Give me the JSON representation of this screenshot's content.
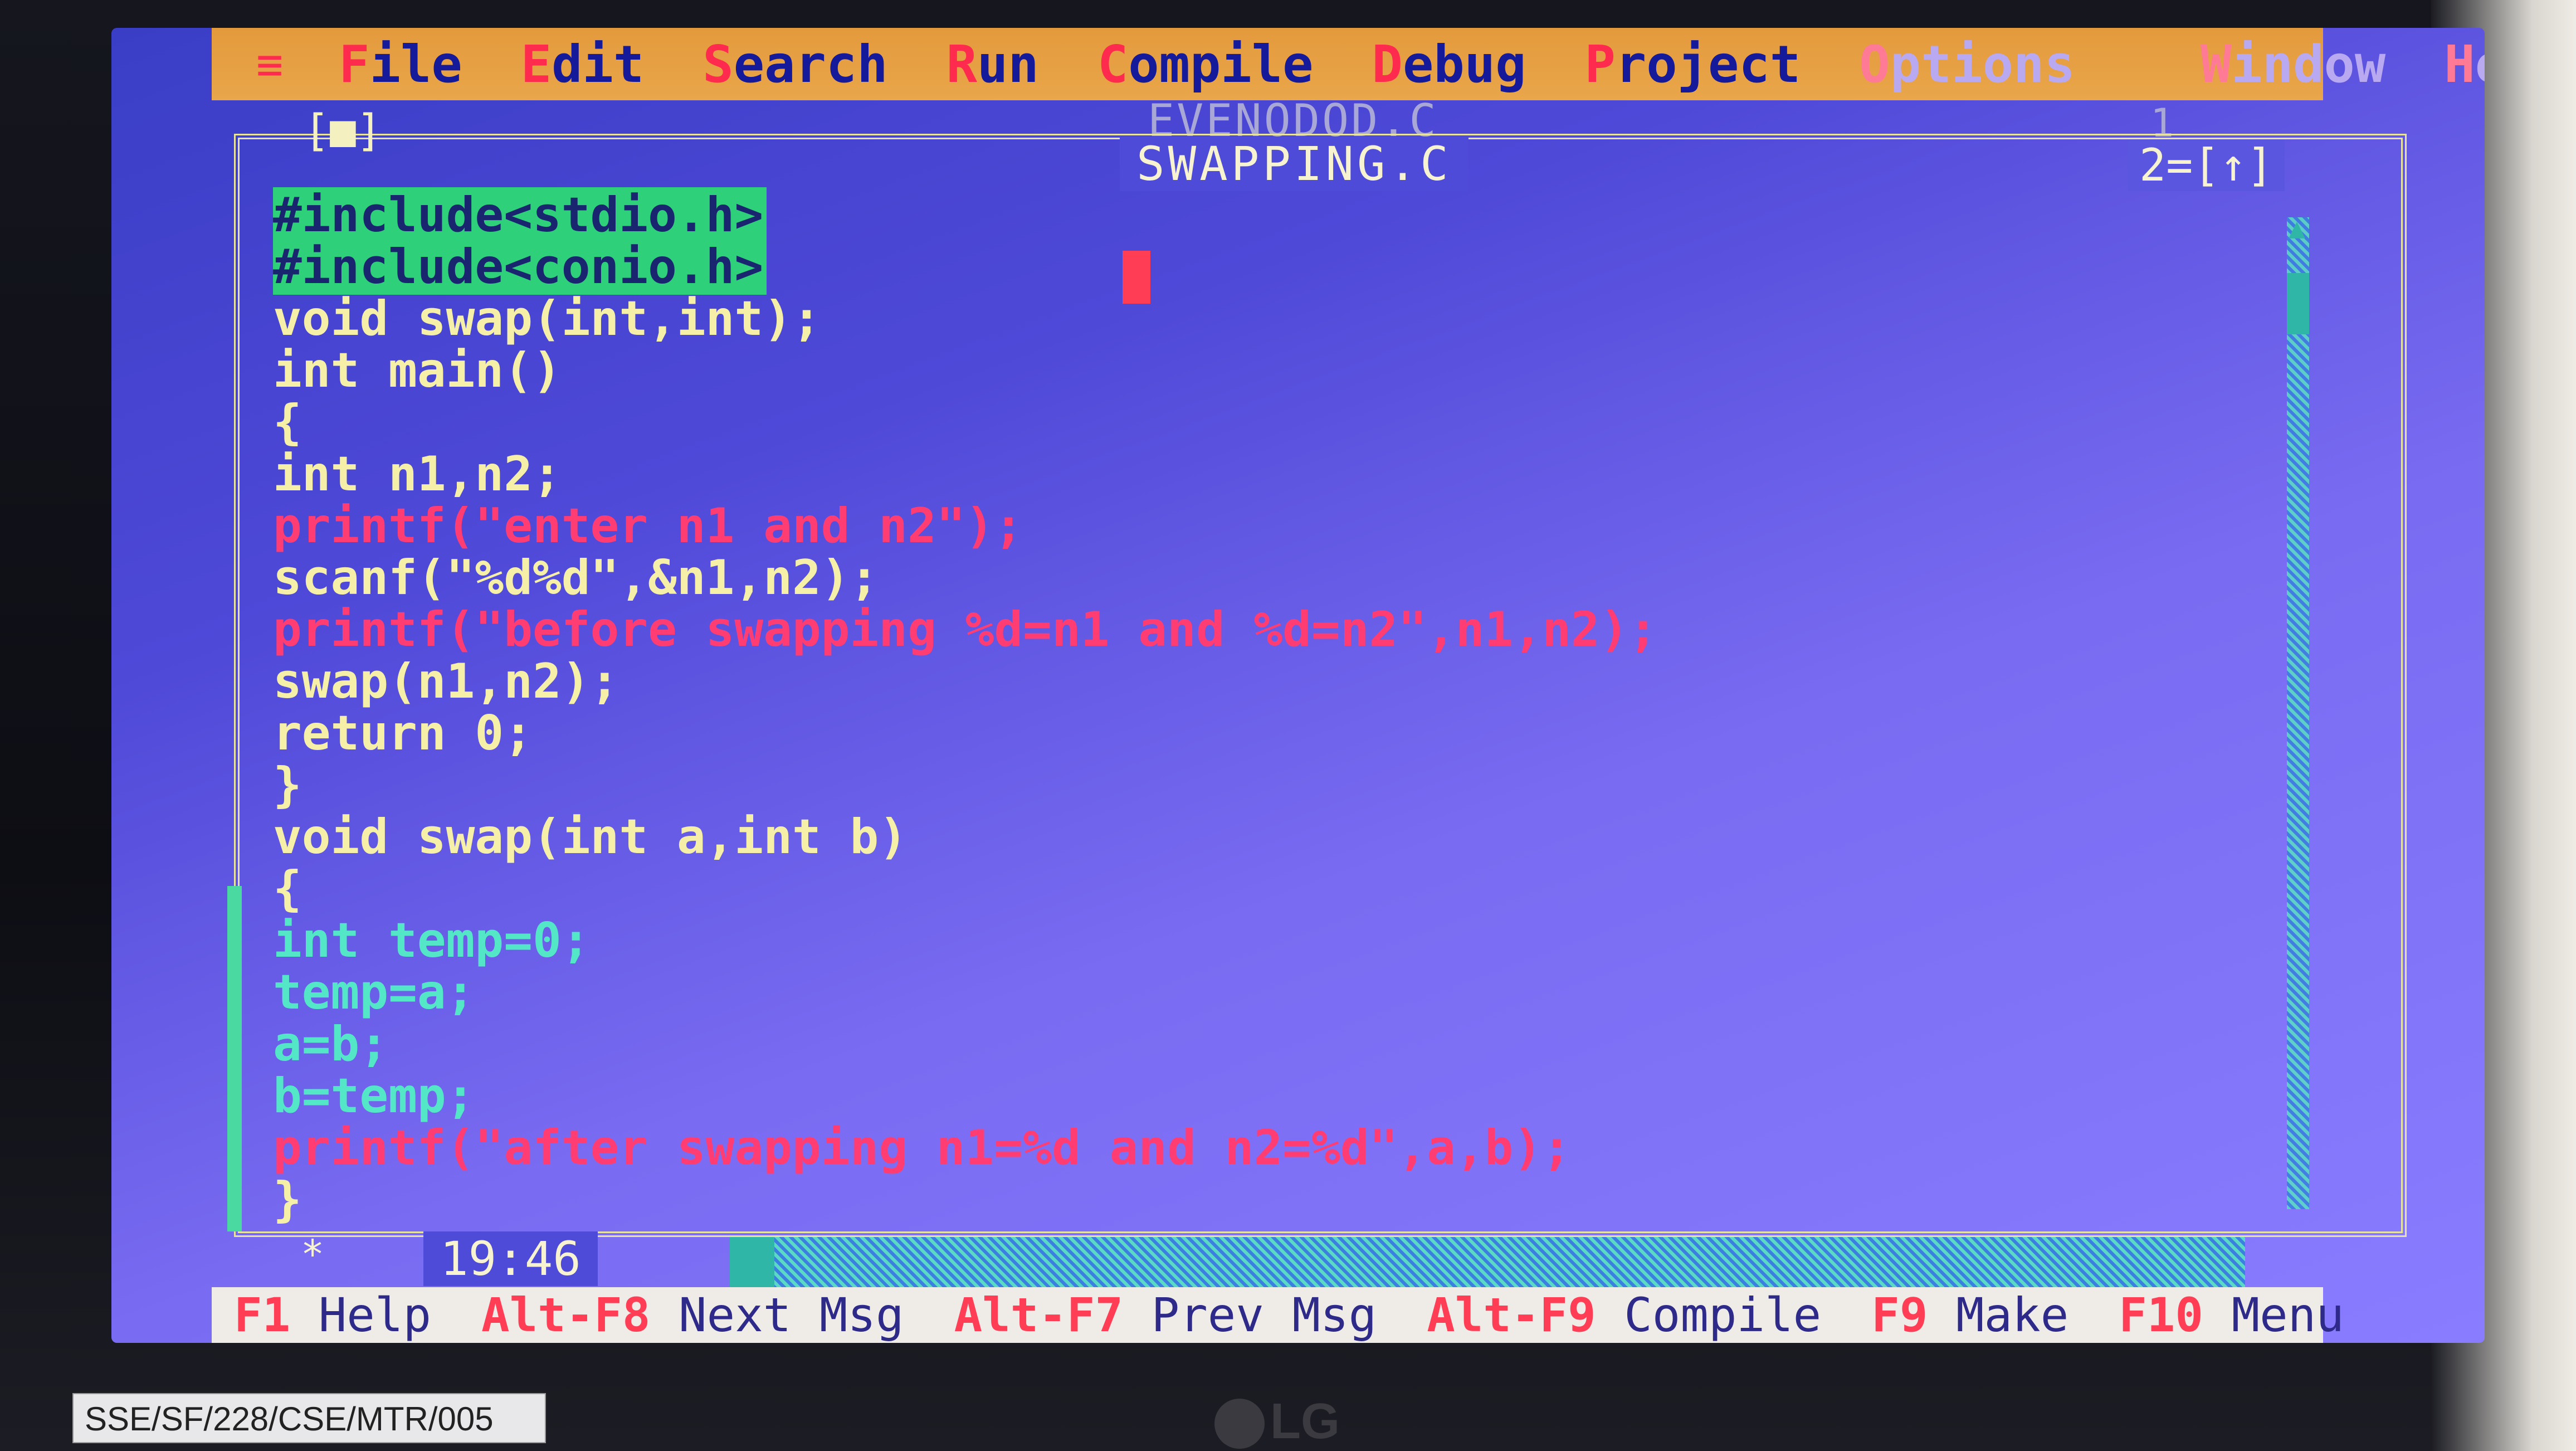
{
  "menubar": {
    "system_icon": "≡",
    "items": [
      {
        "hot": "F",
        "rest": "ile"
      },
      {
        "hot": "E",
        "rest": "dit"
      },
      {
        "hot": "S",
        "rest": "earch"
      },
      {
        "hot": "R",
        "rest": "un"
      },
      {
        "hot": "C",
        "rest": "ompile"
      },
      {
        "hot": "D",
        "rest": "ebug"
      },
      {
        "hot": "P",
        "rest": "roject"
      },
      {
        "hot": "O",
        "rest": "ptions"
      },
      {
        "hot": "W",
        "rest": "indow"
      },
      {
        "hot": "H",
        "rest": "elp"
      }
    ]
  },
  "back_window": {
    "title": "EVENODOD.C",
    "number": "1"
  },
  "window": {
    "close_box": "[■]",
    "title": "SWAPPING.C",
    "number_zoom": "2=[↑]"
  },
  "code": [
    "#include<stdio.h>",
    "#include<conio.h>",
    "void swap(int,int);",
    "int main()",
    "{",
    "int n1,n2;",
    "printf(\"enter n1 and n2\");",
    "scanf(\"%d%d\",&n1,n2);",
    "printf(\"before swapping %d=n1 and %d=n2\",n1,n2);",
    "swap(n1,n2);",
    "return 0;",
    "}",
    "void swap(int a,int b)",
    "{",
    "int temp=0;",
    "temp=a;",
    "a=b;",
    "b=temp;",
    "printf(\"after swapping n1=%d and n2=%d\",a,b);",
    "}"
  ],
  "status": {
    "position": "19:46",
    "modified_marker": "*"
  },
  "fkeys": [
    {
      "key": "F1",
      "label": "Help"
    },
    {
      "key": "Alt-F8",
      "label": "Next Msg"
    },
    {
      "key": "Alt-F7",
      "label": "Prev Msg"
    },
    {
      "key": "Alt-F9",
      "label": "Compile"
    },
    {
      "key": "F9",
      "label": "Make"
    },
    {
      "key": "F10",
      "label": "Menu"
    }
  ],
  "sticker": "SSE/SF/228/CSE/MTR/005",
  "brand": "LG",
  "colors": {
    "menubar": "#e39a3c",
    "editor_bg": "#4f49d8",
    "code_text": "#f5efa8",
    "string": "#ff3d72",
    "highlight": "#2fd07a",
    "hotkey": "#ff2b4f"
  }
}
